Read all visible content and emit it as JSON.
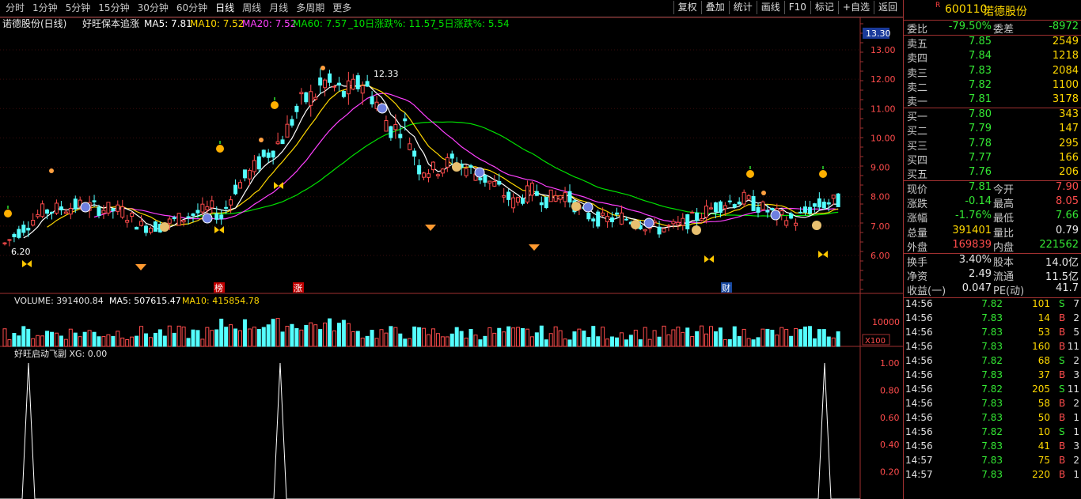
{
  "toolbar": {
    "periods": [
      "分时",
      "1分钟",
      "5分钟",
      "15分钟",
      "30分钟",
      "60分钟",
      "日线",
      "周线",
      "月线",
      "多周期",
      "更多"
    ],
    "tools": [
      "复权",
      "叠加",
      "统计",
      "画线",
      "F10",
      "标记",
      "+自选",
      "返回"
    ]
  },
  "main_chart": {
    "stock_period": "诺德股份(日线)",
    "indicator_name": "好旺保本追涨",
    "ma5_label": "MA5: 7.81",
    "ma10_label": "MA10: 7.52",
    "ma20_label": "MA20: 7.52",
    "ma60_label": "MA60: 7.57",
    "pct10_label": "_10日涨跌%: 11.57",
    "pct5_label": "_5日涨跌%: 5.54",
    "price_top": "13.30",
    "high_marker": "12.33",
    "low_marker": "6.20",
    "y_ticks": [
      "13.00",
      "12.00",
      "11.00",
      "10.00",
      "9.00",
      "8.00",
      "7.00",
      "6.00"
    ],
    "event_tags": [
      "榜",
      "涨",
      "财"
    ]
  },
  "volume_panel": {
    "volume_label": "VOLUME: 391400.84",
    "ma5_label": "MA5: 507615.47",
    "ma10_label": "MA10: 415854.78",
    "tick": "10000",
    "unit": "X100"
  },
  "indicator_panel": {
    "label": "好旺启动飞副 XG: 0.00",
    "y_ticks": [
      "1.00",
      "0.80",
      "0.60",
      "0.40",
      "0.20"
    ]
  },
  "quote": {
    "code": "600110",
    "name": "诺德股份",
    "r_badge": "R",
    "ratio": {
      "label": "委比",
      "value": "-79.50%",
      "label2": "委差",
      "value2": "-8972"
    },
    "asks": [
      {
        "label": "卖五",
        "price": "7.85",
        "vol": "2549"
      },
      {
        "label": "卖四",
        "price": "7.84",
        "vol": "1218"
      },
      {
        "label": "卖三",
        "price": "7.83",
        "vol": "2084"
      },
      {
        "label": "卖二",
        "price": "7.82",
        "vol": "1100"
      },
      {
        "label": "卖一",
        "price": "7.81",
        "vol": "3178"
      }
    ],
    "bids": [
      {
        "label": "买一",
        "price": "7.80",
        "vol": "343"
      },
      {
        "label": "买二",
        "price": "7.79",
        "vol": "147"
      },
      {
        "label": "买三",
        "price": "7.78",
        "vol": "295"
      },
      {
        "label": "买四",
        "price": "7.77",
        "vol": "166"
      },
      {
        "label": "买五",
        "price": "7.76",
        "vol": "206"
      }
    ],
    "stats": [
      {
        "l1": "现价",
        "v1": "7.81",
        "l2": "今开",
        "v2": "7.90"
      },
      {
        "l1": "涨跌",
        "v1": "-0.14",
        "l2": "最高",
        "v2": "8.05"
      },
      {
        "l1": "涨幅",
        "v1": "-1.76%",
        "l2": "最低",
        "v2": "7.66"
      },
      {
        "l1": "总量",
        "v1": "391401",
        "l2": "量比",
        "v2": "0.79"
      },
      {
        "l1": "外盘",
        "v1": "169839",
        "l2": "内盘",
        "v2": "221562"
      }
    ],
    "stats2": [
      {
        "l1": "换手",
        "v1": "3.40%",
        "l2": "股本",
        "v2": "14.0亿"
      },
      {
        "l1": "净资",
        "v1": "2.49",
        "l2": "流通",
        "v2": "11.5亿"
      },
      {
        "l1": "收益(一)",
        "v1": "0.047",
        "l2": "PE(动)",
        "v2": "41.7"
      }
    ],
    "ticks": [
      {
        "t": "14:56",
        "p": "7.82",
        "v": "101",
        "bs": "S",
        "n": "7"
      },
      {
        "t": "14:56",
        "p": "7.83",
        "v": "14",
        "bs": "B",
        "n": "2"
      },
      {
        "t": "14:56",
        "p": "7.83",
        "v": "53",
        "bs": "B",
        "n": "5"
      },
      {
        "t": "14:56",
        "p": "7.83",
        "v": "160",
        "bs": "B",
        "n": "11"
      },
      {
        "t": "14:56",
        "p": "7.82",
        "v": "68",
        "bs": "S",
        "n": "2"
      },
      {
        "t": "14:56",
        "p": "7.83",
        "v": "37",
        "bs": "B",
        "n": "3"
      },
      {
        "t": "14:56",
        "p": "7.82",
        "v": "205",
        "bs": "S",
        "n": "11"
      },
      {
        "t": "14:56",
        "p": "7.83",
        "v": "58",
        "bs": "B",
        "n": "2"
      },
      {
        "t": "14:56",
        "p": "7.83",
        "v": "50",
        "bs": "B",
        "n": "1"
      },
      {
        "t": "14:56",
        "p": "7.82",
        "v": "10",
        "bs": "S",
        "n": "1"
      },
      {
        "t": "14:56",
        "p": "7.83",
        "v": "41",
        "bs": "B",
        "n": "3"
      },
      {
        "t": "14:57",
        "p": "7.83",
        "v": "75",
        "bs": "B",
        "n": "2"
      },
      {
        "t": "14:57",
        "p": "7.83",
        "v": "220",
        "bs": "B",
        "n": "1"
      }
    ]
  },
  "colors": {
    "up": "#ff4c4c",
    "down": "#54ffff",
    "ma5": "#ffffff",
    "ma10": "#ffd800",
    "ma20": "#ff40ff",
    "ma60": "#00e000"
  }
}
